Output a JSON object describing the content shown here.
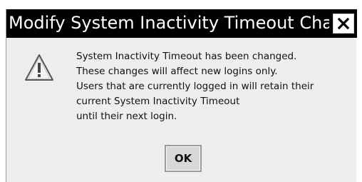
{
  "dialog": {
    "title": "Modify System Inactivity Timeout Cha...",
    "close_glyph": "✕",
    "icon": "warning-icon",
    "message_lines": [
      "System Inactivity Timeout has been changed.",
      "These changes will affect new logins only.",
      "Users that are currently logged in will retain their",
      "current System Inactivity Timeout",
      "until their next login."
    ],
    "ok_label": "OK"
  }
}
